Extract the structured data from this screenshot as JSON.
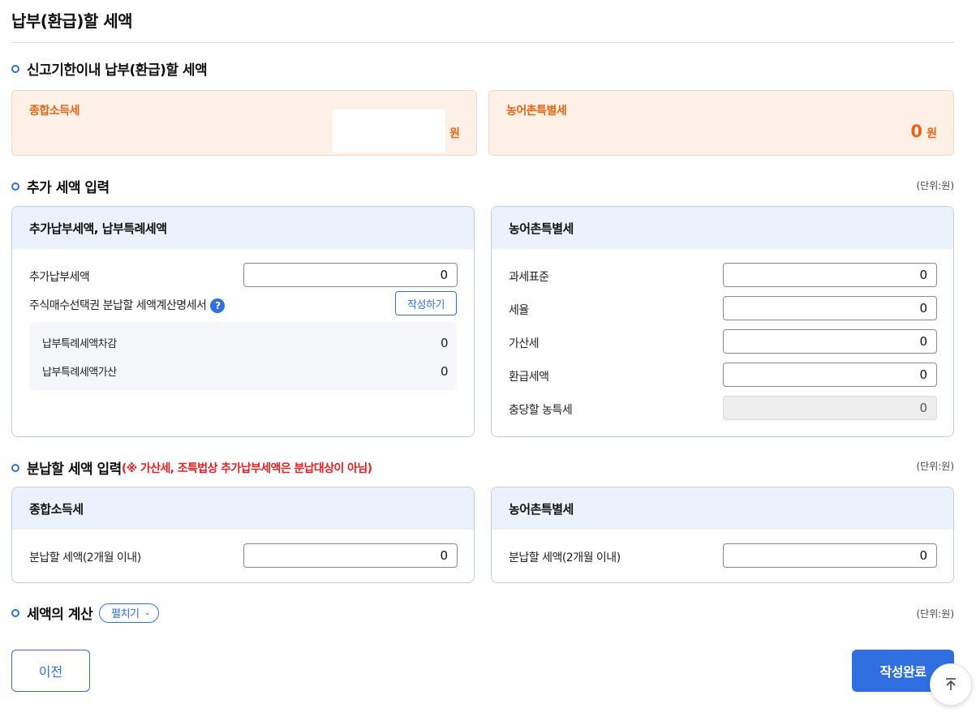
{
  "page": {
    "title": "납부(환급)할 세액"
  },
  "sections": {
    "deadline": {
      "title": "신고기한이내 납부(환급)할 세액"
    },
    "additional": {
      "title": "추가 세액 입력",
      "unit": "(단위:원)"
    },
    "installment": {
      "title": "분납할 세액 입력",
      "warning": "(※ 가산세, 조특법상 추가납부세액은 분납대상이 아님)",
      "unit": "(단위:원)"
    },
    "calc": {
      "title": "세액의 계산",
      "expand_label": "펼치기",
      "unit": "(단위:원)"
    }
  },
  "summary": {
    "income": {
      "label": "종합소득세",
      "won": "원"
    },
    "rural": {
      "label": "농어촌특별세",
      "amount": "0",
      "won": "원"
    }
  },
  "additional_panel": {
    "title": "추가납부세액, 납부특례세액",
    "extra_tax_label": "추가납부세액",
    "extra_tax_value": "0",
    "stock_option_label": "주식매수선택권 분납할 세액계산명세서",
    "help_icon": "?",
    "write_button": "작성하기",
    "deduction_label": "납부특례세액차감",
    "deduction_value": "0",
    "addition_label": "납부특례세액가산",
    "addition_value": "0"
  },
  "rural_panel": {
    "title": "농어촌특별세",
    "rows": [
      {
        "label": "과세표준",
        "value": "0"
      },
      {
        "label": "세율",
        "value": "0"
      },
      {
        "label": "가산세",
        "value": "0"
      },
      {
        "label": "환급세액",
        "value": "0"
      },
      {
        "label": "충당할 농특세",
        "value": "0"
      }
    ]
  },
  "installment_panels": {
    "income": {
      "title": "종합소득세",
      "label": "분납할 세액(2개월 이내)",
      "value": "0"
    },
    "rural": {
      "title": "농어촌특별세",
      "label": "분납할 세액(2개월 이내)",
      "value": "0"
    }
  },
  "footer": {
    "prev": "이전",
    "done": "작성완료"
  },
  "icons": {
    "expand": "chevron-down-icon",
    "top": "arrow-up-icon"
  },
  "colors": {
    "accent": "#2f6fe0",
    "orange": "#e56516",
    "warning": "#e42020"
  }
}
